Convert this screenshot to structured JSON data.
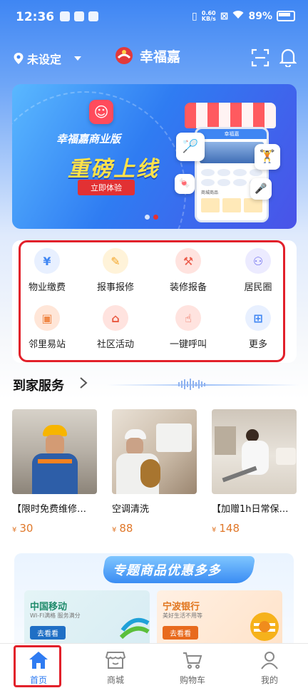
{
  "status_bar": {
    "time": "12:36",
    "speed_value": "0.60",
    "speed_unit": "KB/s",
    "battery": "89%"
  },
  "header": {
    "location": "未设定",
    "app_name": "幸福嘉",
    "icons": [
      "location-pin-icon",
      "dropdown-caret-icon",
      "scan-icon",
      "bell-icon"
    ]
  },
  "banner": {
    "subtitle": "幸福嘉商业版",
    "title": "重磅上线",
    "button": "立即体验",
    "phone_app_label": "幸福嘉",
    "phone_section_label": "商城商品"
  },
  "services": [
    {
      "label": "物业缴费",
      "icon": "payment-icon",
      "color": "#e8f0ff",
      "fg": "#3f86f3"
    },
    {
      "label": "报事报修",
      "icon": "report-icon",
      "color": "#fff3d9",
      "fg": "#f4a62a"
    },
    {
      "label": "装修报备",
      "icon": "decoration-icon",
      "color": "#ffe3df",
      "fg": "#ec5b4a"
    },
    {
      "label": "居民圈",
      "icon": "community-icon",
      "color": "#ecebff",
      "fg": "#6e6ef0"
    },
    {
      "label": "邻里易站",
      "icon": "box-icon",
      "color": "#ffe6d8",
      "fg": "#f08a4a"
    },
    {
      "label": "社区活动",
      "icon": "activity-icon",
      "color": "#ffe3df",
      "fg": "#e9573f"
    },
    {
      "label": "一键呼叫",
      "icon": "call-icon",
      "color": "#ffe3df",
      "fg": "#e9573f"
    },
    {
      "label": "更多",
      "icon": "more-icon",
      "color": "#e8f0ff",
      "fg": "#3f86f3"
    }
  ],
  "home_services": {
    "title": "到家服务",
    "items": [
      {
        "name": "【限时免费维修…",
        "currency": "¥",
        "price": "30"
      },
      {
        "name": "空调清洗",
        "currency": "¥",
        "price": "88"
      },
      {
        "name": "【加赠1h日常保…",
        "currency": "¥",
        "price": "148"
      }
    ]
  },
  "promo": {
    "title": "专题商品优惠多多",
    "cards": [
      {
        "name": "中国移动",
        "desc": "WI-FI满格 服务满分",
        "button": "去看看",
        "bg": "#e3f5f0",
        "accent": "#1f8b6b",
        "btn": "#1f6fc5"
      },
      {
        "name": "宁波银行",
        "desc": "美好生活不用等",
        "button": "去看看",
        "bg": "#ffeede",
        "accent": "#e1761f",
        "btn": "#e86a1d"
      }
    ]
  },
  "tabs": [
    {
      "label": "首页",
      "icon": "home-icon",
      "active": true
    },
    {
      "label": "商城",
      "icon": "shop-icon",
      "active": false
    },
    {
      "label": "购物车",
      "icon": "cart-icon",
      "active": false
    },
    {
      "label": "我的",
      "icon": "profile-icon",
      "active": false
    }
  ]
}
